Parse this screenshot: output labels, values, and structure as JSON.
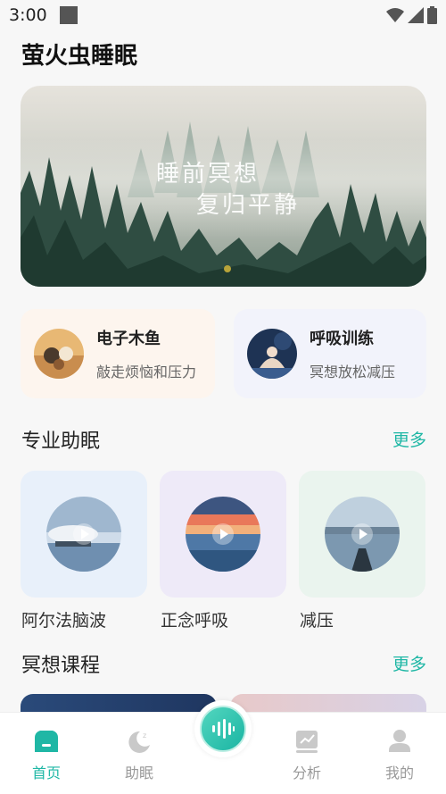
{
  "status_bar": {
    "time": "3:00"
  },
  "app": {
    "title": "萤火虫睡眠"
  },
  "banner": {
    "line1": "睡前冥想",
    "line2": "复归平静"
  },
  "quick_cards": [
    {
      "title": "电子木鱼",
      "subtitle": "敲走烦恼和压力"
    },
    {
      "title": "呼吸训练",
      "subtitle": "冥想放松减压"
    }
  ],
  "sections": {
    "professional": {
      "title": "专业助眠",
      "more": "更多"
    },
    "meditation": {
      "title": "冥想课程",
      "more": "更多"
    }
  },
  "pro_items": [
    {
      "label": "阿尔法脑波"
    },
    {
      "label": "正念呼吸"
    },
    {
      "label": "减压"
    }
  ],
  "tabbar": {
    "items": [
      {
        "label": "首页",
        "icon": "home-icon",
        "active": true
      },
      {
        "label": "助眠",
        "icon": "moon-icon",
        "active": false
      },
      {
        "label": "",
        "icon": "sound-wave-icon",
        "active": false
      },
      {
        "label": "分析",
        "icon": "chart-icon",
        "active": false
      },
      {
        "label": "我的",
        "icon": "profile-icon",
        "active": false
      }
    ]
  },
  "colors": {
    "accent": "#1fb7a5",
    "background": "#f7f7f7"
  }
}
